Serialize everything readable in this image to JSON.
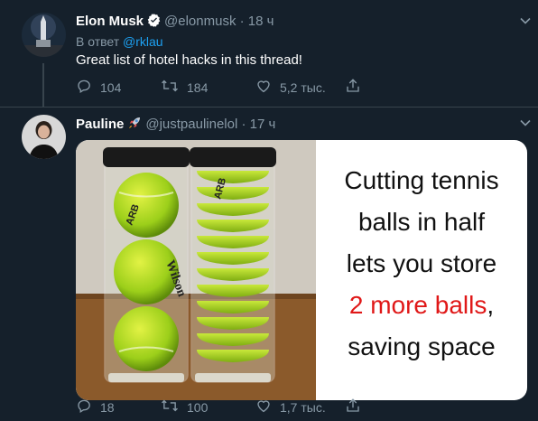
{
  "tweet1": {
    "author_name": "Elon Musk",
    "author_handle": "@elonmusk",
    "separator": "·",
    "time": "18 ч",
    "reply_prefix": "В ответ",
    "reply_handle": "@rklau",
    "text": "Great list of hotel hacks in this thread!",
    "replies": "104",
    "retweets": "184",
    "likes": "5,2 тыс."
  },
  "tweet2": {
    "author_name": "Pauline",
    "author_handle": "@justpaulinelol",
    "separator": "·",
    "time": "17 ч",
    "image_caption": {
      "line1": "Cutting tennis",
      "line2": "balls in half",
      "line3": "lets you store",
      "line4_red": "2 more balls",
      "line4_rest": ",",
      "line5": "saving space"
    },
    "ball_prints": [
      "ARB",
      "Wilson",
      "ARB"
    ],
    "replies": "18",
    "retweets": "100",
    "likes": "1,7 тыс."
  },
  "colors": {
    "background": "#15202b",
    "muted_text": "#8899a6",
    "link": "#1da1f2",
    "divider": "#38444d",
    "caption_red": "#e01818"
  },
  "icons": [
    "verified-badge-icon",
    "rocket-icon",
    "chevron-down-icon",
    "reply-icon",
    "retweet-icon",
    "like-icon",
    "share-icon"
  ]
}
